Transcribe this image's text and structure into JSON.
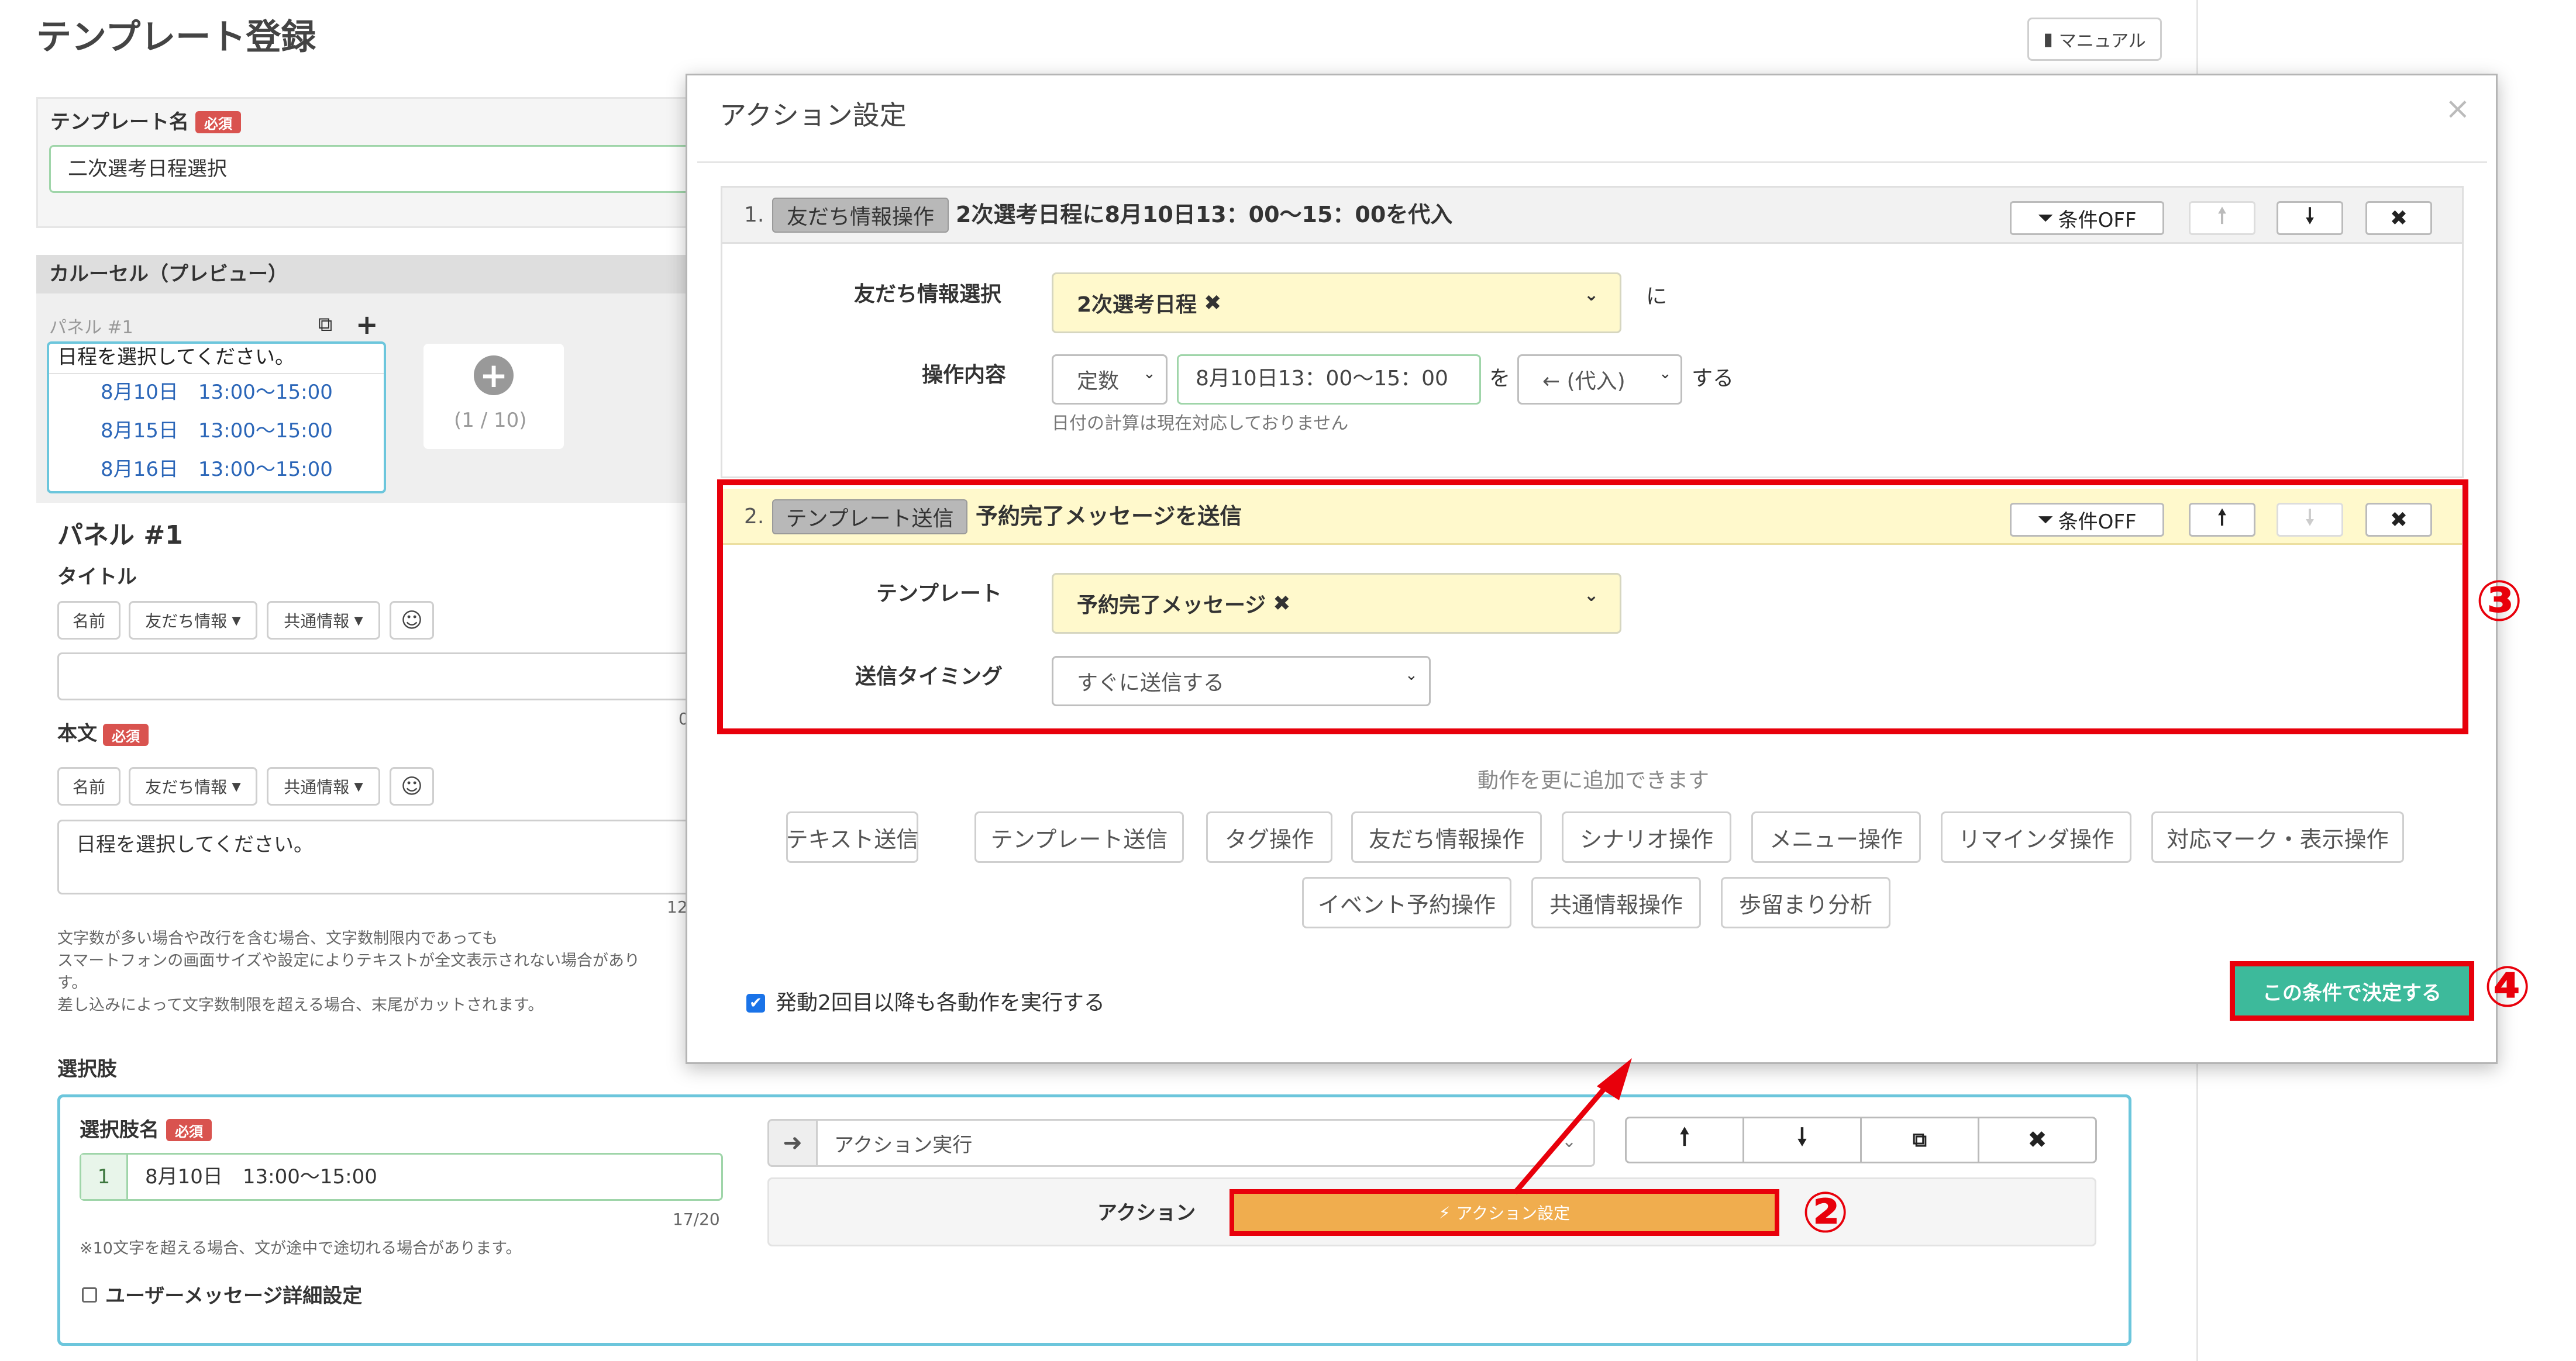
{
  "page": {
    "title": "テンプレート登録",
    "manual_label": "マニュアル",
    "template_name_label": "テンプレート名",
    "required_badge": "必須",
    "template_name_value": "二次選考日程選択",
    "carousel_header": "カルーセル（プレビュー）",
    "panel_small_label": "パネル #1",
    "preview_text": "日程を選択してください。",
    "preview_options": [
      "8月10日　13:00〜15:00",
      "8月15日　13:00〜15:00",
      "8月16日　13:00〜15:00"
    ],
    "add_panel_counter": "(1 / 10)",
    "panel_heading": "パネル #1",
    "title_label": "タイトル",
    "body_label": "本文",
    "insert_name": "名前",
    "insert_friend_info": "友だち情報",
    "insert_common_info": "共通情報",
    "body_value": "日程を選択してください。",
    "title_counter": "0",
    "body_counter": "12",
    "notes": [
      "文字数が多い場合や改行を含む場合、文字数制限内であっても",
      "スマートフォンの画面サイズや設定によりテキストが全文表示されない場合があり",
      "す。",
      "差し込みによって文字数制限を超える場合、末尾がカットされます。"
    ],
    "choices_label": "選択肢",
    "choice_name_label": "選択肢名",
    "choice_index": "1",
    "choice_value": "8月10日　13:00〜15:00",
    "choice_counter": "17/20",
    "choice_note": "※10文字を超える場合、文が途中で途切れる場合があります。",
    "user_message_detail": "ユーザーメッセージ詳細設定",
    "action_select": "アクション実行",
    "action_label": "アクション",
    "action_settings_button": "アクション設定"
  },
  "modal": {
    "title": "アクション設定",
    "close": "×",
    "condition_off": "条件OFF",
    "action1": {
      "index": "1.",
      "tag": "友だち情報操作",
      "summary": "2次選考日程に8月10日13：00〜15：00を代入",
      "friend_info_label": "友だち情報選択",
      "friend_info_value": "2次選考日程",
      "ni": "に",
      "operation_label": "操作内容",
      "op_type": "定数",
      "op_value": "8月10日13：00〜15：00",
      "wo": "を",
      "op_method": "← (代入)",
      "suru": "する",
      "date_note": "日付の計算は現在対応しておりません"
    },
    "action2": {
      "index": "2.",
      "tag": "テンプレート送信",
      "summary": "予約完了メッセージを送信",
      "template_label": "テンプレート",
      "template_value": "予約完了メッセージ",
      "timing_label": "送信タイミング",
      "timing_value": "すぐに送信する"
    },
    "add_more": "動作を更に追加できます",
    "action_buttons_row1": [
      "テキスト送信",
      "テンプレート送信",
      "タグ操作",
      "友だち情報操作",
      "シナリオ操作",
      "メニュー操作",
      "リマインダ操作",
      "対応マーク・表示操作"
    ],
    "action_buttons_row2": [
      "イベント予約操作",
      "共通情報操作",
      "歩留まり分析"
    ],
    "repeat_checkbox": "発動2回目以降も各動作を実行する",
    "confirm_button": "この条件で決定する"
  },
  "annotations": {
    "step2": "②",
    "step3": "③",
    "step4": "④",
    "color": "#e8000b"
  },
  "colors": {
    "accent_green": "#3dba9b",
    "action_orange": "#f0ad4e",
    "highlight_yellow": "#fff9cc"
  }
}
